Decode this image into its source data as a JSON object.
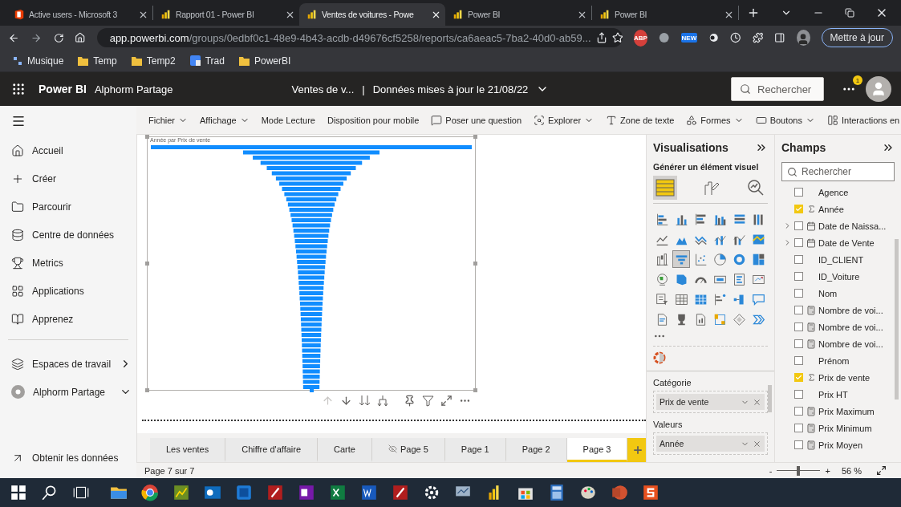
{
  "browser": {
    "tabs": [
      {
        "title": "Active users - Microsoft 3",
        "selected": false,
        "kind": "office"
      },
      {
        "title": "Rapport 01 - Power BI",
        "selected": false,
        "kind": "powerbi"
      },
      {
        "title": "Ventes de voitures - Powe",
        "selected": true,
        "kind": "powerbi"
      },
      {
        "title": "Power BI",
        "selected": false,
        "kind": "powerbi"
      },
      {
        "title": "Power BI",
        "selected": false,
        "kind": "powerbi"
      }
    ],
    "url_host": "app.powerbi.com",
    "url_path": "/groups/0edbf0c1-48e9-4b43-acdb-d49676cf5258/reports/ca6aeac5-7ba2-40d0-ab59...",
    "extensions": [
      {
        "kind": "adblock",
        "label": "ABP"
      },
      {
        "kind": "skype"
      },
      {
        "kind": "new",
        "label": "NEW"
      },
      {
        "kind": "toggle"
      },
      {
        "kind": "clock"
      },
      {
        "kind": "puzzle"
      },
      {
        "kind": "sidepanel"
      }
    ],
    "update_button": "Mettre à jour",
    "bookmarks": [
      {
        "label": "Musique",
        "kind": "app"
      },
      {
        "label": "Temp",
        "kind": "folder"
      },
      {
        "label": "Temp2",
        "kind": "folder"
      },
      {
        "label": "Trad",
        "kind": "translate"
      },
      {
        "label": "PowerBI",
        "kind": "folder"
      }
    ]
  },
  "app": {
    "brand": "Power BI",
    "workspace": "Alphorm Partage",
    "report": "Ventes de v...",
    "separator": "|",
    "refresh": "Données mises à jour le 21/08/22",
    "search": "Rechercher",
    "notification_count": "1"
  },
  "nav": {
    "items": [
      {
        "label": "Accueil"
      },
      {
        "label": "Créer"
      },
      {
        "label": "Parcourir"
      },
      {
        "label": "Centre de données"
      },
      {
        "label": "Metrics"
      },
      {
        "label": "Applications"
      },
      {
        "label": "Apprenez"
      }
    ],
    "workspaces": [
      {
        "label": "Espaces de travail",
        "expanded": false,
        "kind": "section"
      },
      {
        "label": "Alphorm Partage",
        "expanded": true,
        "kind": "workspace"
      }
    ],
    "footer": "Obtenir les données"
  },
  "toolbar": [
    {
      "label": "Fichier",
      "dropdown": true
    },
    {
      "label": "Affichage",
      "dropdown": true
    },
    {
      "label": "Mode Lecture",
      "dropdown": false
    },
    {
      "label": "Disposition pour mobile",
      "dropdown": false
    },
    {
      "label": "Poser une question",
      "dropdown": false
    },
    {
      "label": "Explorer",
      "dropdown": true
    },
    {
      "label": "Zone de texte",
      "dropdown": false
    },
    {
      "label": "Formes",
      "dropdown": true
    },
    {
      "label": "Boutons",
      "dropdown": true
    },
    {
      "label": "Interactions en",
      "dropdown": false
    }
  ],
  "visual": {
    "title": "Année par Prix de vente",
    "actions": [
      {
        "disabled": true
      },
      {
        "disabled": false
      },
      {
        "disabled": false
      },
      {
        "disabled": false
      },
      {
        "disabled": false
      },
      {
        "disabled": false
      },
      {
        "disabled": false
      },
      {
        "disabled": false
      }
    ]
  },
  "pages": [
    {
      "label": "Les ventes",
      "selected": false,
      "hidden": false
    },
    {
      "label": "Chiffre d'affaire",
      "selected": false,
      "hidden": false
    },
    {
      "label": "Carte",
      "selected": false,
      "hidden": false
    },
    {
      "label": "Page 5",
      "selected": false,
      "hidden": true
    },
    {
      "label": "Page 1",
      "selected": false,
      "hidden": false
    },
    {
      "label": "Page 2",
      "selected": false,
      "hidden": false
    },
    {
      "label": "Page 3",
      "selected": true,
      "hidden": false
    }
  ],
  "status": "Page 7 sur 7",
  "zoom": {
    "minus": "-",
    "plus": "+",
    "reading": "56 %",
    "level": 0.5
  },
  "visualizations": {
    "title": "Visualisations",
    "subtitle": "Générer un élément visuel",
    "modes": [
      {
        "selected": true
      },
      {
        "selected": false
      },
      {
        "selected": false
      }
    ],
    "types": [
      {
        "selected": false
      },
      {
        "selected": false
      },
      {
        "selected": false
      },
      {
        "selected": false
      },
      {
        "selected": false
      },
      {
        "selected": false
      },
      {
        "selected": false
      },
      {
        "selected": false
      },
      {
        "selected": false
      },
      {
        "selected": false
      },
      {
        "selected": false
      },
      {
        "selected": false
      },
      {
        "selected": false
      },
      {
        "selected": true
      },
      {
        "selected": false
      },
      {
        "selected": false
      },
      {
        "selected": false
      },
      {
        "selected": false
      },
      {
        "selected": false
      },
      {
        "selected": false
      },
      {
        "selected": false
      },
      {
        "selected": false
      },
      {
        "selected": false
      },
      {
        "selected": false
      },
      {
        "selected": false
      },
      {
        "selected": false
      },
      {
        "selected": false
      },
      {
        "selected": false
      },
      {
        "selected": false
      },
      {
        "selected": false
      },
      {
        "selected": false
      },
      {
        "selected": false
      },
      {
        "selected": false
      },
      {
        "selected": false
      },
      {
        "selected": false
      },
      {
        "selected": false
      }
    ],
    "wells": [
      {
        "label": "Catégorie",
        "field": "Prix de vente"
      },
      {
        "label": "Valeurs",
        "field": "Année"
      }
    ]
  },
  "fields": {
    "title": "Champs",
    "placeholder": "Rechercher",
    "items": [
      {
        "name": "Agence",
        "kind": "plain",
        "checked": false,
        "expandable": false
      },
      {
        "name": "Année",
        "kind": "sum",
        "checked": true,
        "expandable": false
      },
      {
        "name": "Date de Naissa...",
        "kind": "date",
        "checked": false,
        "expandable": true
      },
      {
        "name": "Date de Vente",
        "kind": "date",
        "checked": false,
        "expandable": true
      },
      {
        "name": "ID_CLIENT",
        "kind": "plain",
        "checked": false,
        "expandable": false
      },
      {
        "name": "ID_Voiture",
        "kind": "plain",
        "checked": false,
        "expandable": false
      },
      {
        "name": "Nom",
        "kind": "plain",
        "checked": false,
        "expandable": false
      },
      {
        "name": "Nombre de voi...",
        "kind": "measure",
        "checked": false,
        "expandable": false
      },
      {
        "name": "Nombre de voi...",
        "kind": "measure",
        "checked": false,
        "expandable": false
      },
      {
        "name": "Nombre de voi...",
        "kind": "measure",
        "checked": false,
        "expandable": false
      },
      {
        "name": "Prénom",
        "kind": "plain",
        "checked": false,
        "expandable": false
      },
      {
        "name": "Prix de vente",
        "kind": "sum",
        "checked": true,
        "expandable": false
      },
      {
        "name": "Prix HT",
        "kind": "plain",
        "checked": false,
        "expandable": false
      },
      {
        "name": "Prix Maximum",
        "kind": "measure",
        "checked": false,
        "expandable": false
      },
      {
        "name": "Prix Minimum",
        "kind": "measure",
        "checked": false,
        "expandable": false
      },
      {
        "name": "Prix Moyen",
        "kind": "measure",
        "checked": false,
        "expandable": false
      }
    ]
  }
}
